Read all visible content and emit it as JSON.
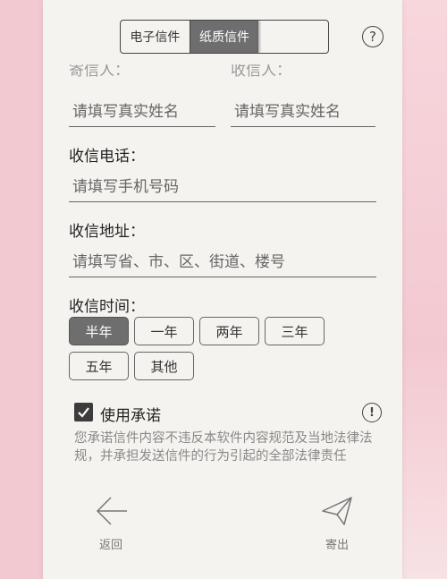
{
  "tabs": [
    {
      "label": "电子信件",
      "active": false
    },
    {
      "label": "纸质信件",
      "active": true
    },
    {
      "label": " ",
      "active": false,
      "obscured": true
    }
  ],
  "header": {
    "help_icon": "question-circle-icon",
    "help_glyph": "?"
  },
  "sender": {
    "cut_label": "寄信人："
  },
  "recipient": {
    "cut_label": "收信人：",
    "sender_name_placeholder": "请填写真实姓名",
    "recipient_name_placeholder": "请填写真实姓名"
  },
  "phone": {
    "label": "收信电话：",
    "placeholder": "请填写手机号码"
  },
  "address": {
    "label": "收信地址：",
    "placeholder": "请填写省、市、区、街道、楼号"
  },
  "time": {
    "label": "收信时间：",
    "options": [
      "半年",
      "一年",
      "两年",
      "三年",
      "五年",
      "其他"
    ],
    "selected": "半年"
  },
  "promise": {
    "label": "使用承诺",
    "checked": true,
    "info_glyph": "!",
    "notice": "您承诺信件内容不违反本软件内容规范及当地法律法规，并承担发送信件的行为引起的全部法律责任"
  },
  "bottom_nav": {
    "back_label": "返回",
    "send_label": "寄出"
  },
  "colors": {
    "background": "#f3c9d1",
    "paper": "#f4f3ef",
    "active": "#6e6e6e"
  }
}
